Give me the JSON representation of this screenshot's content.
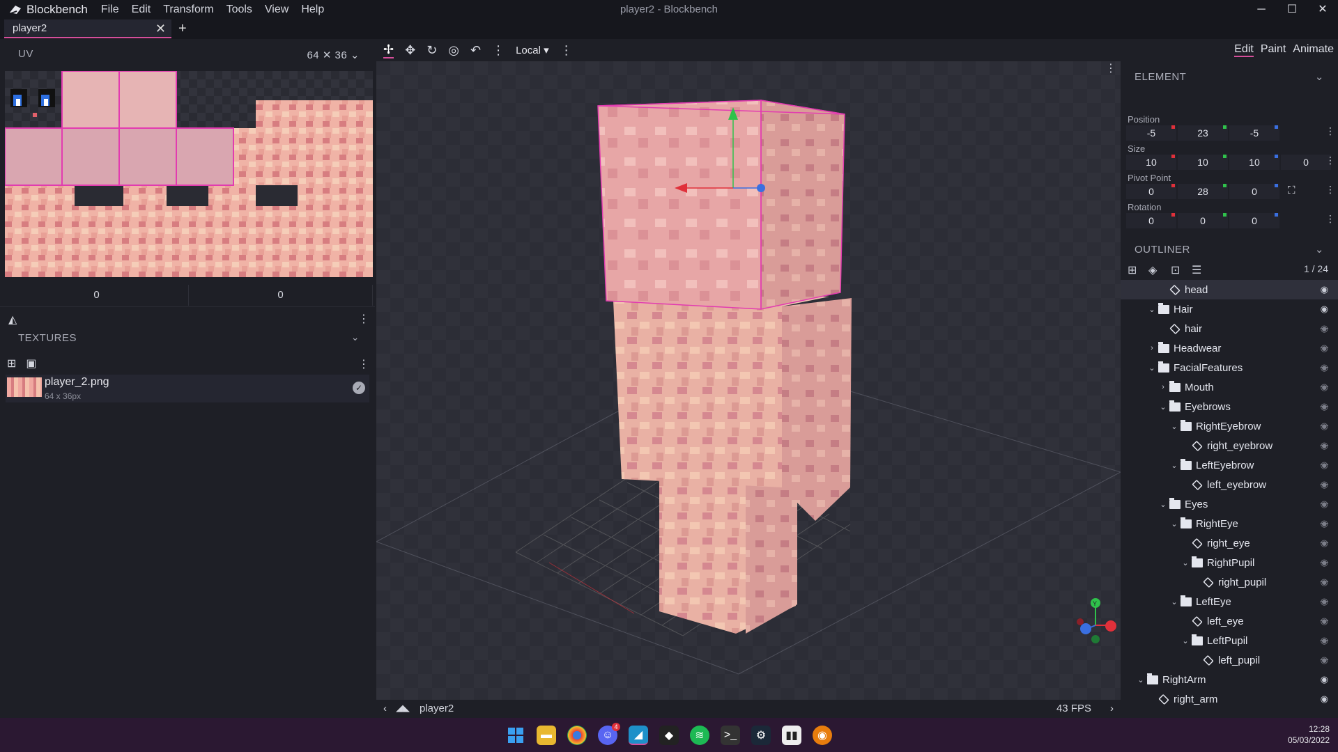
{
  "app": {
    "name": "Blockbench",
    "window_title": "player2 - Blockbench"
  },
  "menu": [
    "File",
    "Edit",
    "Transform",
    "Tools",
    "View",
    "Help"
  ],
  "tab": {
    "label": "player2"
  },
  "uv": {
    "title": "UV",
    "size": "64 ✕ 36",
    "coord_x": "0",
    "coord_y": "0"
  },
  "textures": {
    "title": "TEXTURES",
    "file_name": "player_2.png",
    "file_dims": "64 x 36px"
  },
  "toolbar": {
    "space": "Local"
  },
  "modes": [
    "Edit",
    "Paint",
    "Animate"
  ],
  "element": {
    "title": "ELEMENT",
    "position_label": "Position",
    "position": [
      "-5",
      "23",
      "-5"
    ],
    "size_label": "Size",
    "size": [
      "10",
      "10",
      "10",
      "0"
    ],
    "pivot_label": "Pivot Point",
    "pivot": [
      "0",
      "28",
      "0"
    ],
    "rotation_label": "Rotation",
    "rotation": [
      "0",
      "0",
      "0"
    ]
  },
  "outliner": {
    "title": "OUTLINER",
    "count": "1 / 24",
    "items": [
      {
        "label": "head",
        "type": "cube",
        "depth": 3,
        "chev": "",
        "visible": true,
        "selected": true
      },
      {
        "label": "Hair",
        "type": "folder",
        "depth": 2,
        "chev": "⌄",
        "visible": true
      },
      {
        "label": "hair",
        "type": "cube",
        "depth": 3,
        "chev": "",
        "visible": false
      },
      {
        "label": "Headwear",
        "type": "folder",
        "depth": 2,
        "chev": "›",
        "visible": false
      },
      {
        "label": "FacialFeatures",
        "type": "folder",
        "depth": 2,
        "chev": "⌄",
        "visible": false
      },
      {
        "label": "Mouth",
        "type": "folder",
        "depth": 3,
        "chev": "›",
        "visible": false
      },
      {
        "label": "Eyebrows",
        "type": "folder",
        "depth": 3,
        "chev": "⌄",
        "visible": false
      },
      {
        "label": "RightEyebrow",
        "type": "folder",
        "depth": 4,
        "chev": "⌄",
        "visible": false
      },
      {
        "label": "right_eyebrow",
        "type": "cube",
        "depth": 5,
        "chev": "",
        "visible": false
      },
      {
        "label": "LeftEyebrow",
        "type": "folder",
        "depth": 4,
        "chev": "⌄",
        "visible": false
      },
      {
        "label": "left_eyebrow",
        "type": "cube",
        "depth": 5,
        "chev": "",
        "visible": false
      },
      {
        "label": "Eyes",
        "type": "folder",
        "depth": 3,
        "chev": "⌄",
        "visible": false
      },
      {
        "label": "RightEye",
        "type": "folder",
        "depth": 4,
        "chev": "⌄",
        "visible": false
      },
      {
        "label": "right_eye",
        "type": "cube",
        "depth": 5,
        "chev": "",
        "visible": false
      },
      {
        "label": "RightPupil",
        "type": "folder",
        "depth": 5,
        "chev": "⌄",
        "visible": false
      },
      {
        "label": "right_pupil",
        "type": "cube",
        "depth": 6,
        "chev": "",
        "visible": false
      },
      {
        "label": "LeftEye",
        "type": "folder",
        "depth": 4,
        "chev": "⌄",
        "visible": false
      },
      {
        "label": "left_eye",
        "type": "cube",
        "depth": 5,
        "chev": "",
        "visible": false
      },
      {
        "label": "LeftPupil",
        "type": "folder",
        "depth": 5,
        "chev": "⌄",
        "visible": false
      },
      {
        "label": "left_pupil",
        "type": "cube",
        "depth": 6,
        "chev": "",
        "visible": false
      },
      {
        "label": "RightArm",
        "type": "folder",
        "depth": 1,
        "chev": "⌄",
        "visible": true
      },
      {
        "label": "right_arm",
        "type": "cube",
        "depth": 2,
        "chev": "",
        "visible": true
      }
    ]
  },
  "status": {
    "model": "player2",
    "fps": "43 FPS"
  },
  "taskbar": {
    "time": "12:28",
    "date": "05/03/2022",
    "discord_badge": "4"
  },
  "colors": {
    "accent": "#d64e9a",
    "skin": "#eba59c",
    "skin_dark": "#c97a80",
    "axis_x": "#e0303a",
    "axis_y": "#2fc24b",
    "axis_z": "#3a6fe0"
  }
}
